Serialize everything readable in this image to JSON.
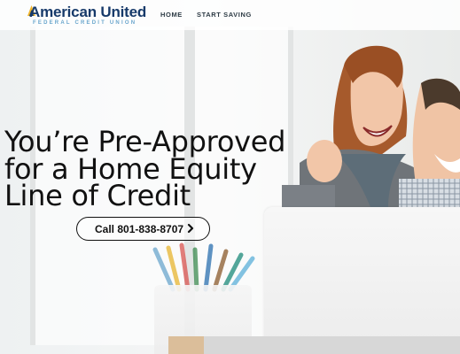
{
  "brand": {
    "name": "American United",
    "subtitle": "FEDERAL CREDIT UNION",
    "accent": "#173a6a",
    "secondary": "#6aa6cd"
  },
  "nav": {
    "items": [
      {
        "label": "HOME"
      },
      {
        "label": "START SAVING"
      }
    ]
  },
  "hero": {
    "headline": "You’re Pre-Approved for a Home Equity Line of Credit",
    "cta_label": "Call 801-838-8707",
    "cta_icon": "chevron-right-icon"
  }
}
